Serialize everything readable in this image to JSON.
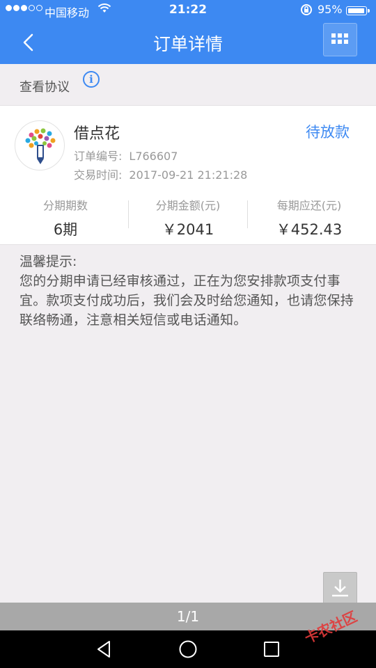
{
  "status_bar": {
    "carrier": "中国移动",
    "signal_strength": 3,
    "signal_max": 5,
    "time": "21:22",
    "battery_text": "95%",
    "battery_level": 0.95,
    "icons": [
      "wifi-icon",
      "rotation-lock-icon",
      "battery-icon"
    ]
  },
  "navbar": {
    "title": "订单详情",
    "back_icon": "chevron-left-icon",
    "menu_icon": "grid-icon",
    "color": "#3d89f2"
  },
  "agreement": {
    "label": "查看协议",
    "icon": "info-icon"
  },
  "order": {
    "product_name": "借点花",
    "status": "待放款",
    "order_no_label": "订单编号:",
    "order_no": "L766607",
    "time_label": "交易时间:",
    "time": "2017-09-21 21:21:28",
    "stats": [
      {
        "label": "分期期数",
        "value": "6期"
      },
      {
        "label": "分期金额(元)",
        "value": "￥2041"
      },
      {
        "label": "每期应还(元)",
        "value": "￥452.43"
      }
    ]
  },
  "tips": {
    "title": "温馨提示:",
    "body": "您的分期申请已经审核通过，正在为您安排款项支付事宜。款项支付成功后，我们会及时给您通知，也请您保持联络畅通，注意相关短信或电话通知。"
  },
  "pager": {
    "text": "1/1"
  },
  "download_icon": "download-icon",
  "android_nav": [
    "back-triangle-icon",
    "home-circle-icon",
    "recents-square-icon"
  ],
  "watermark": {
    "text": "卡农社区"
  },
  "colors": {
    "accent": "#3d89f2",
    "background": "#f1eef1"
  }
}
